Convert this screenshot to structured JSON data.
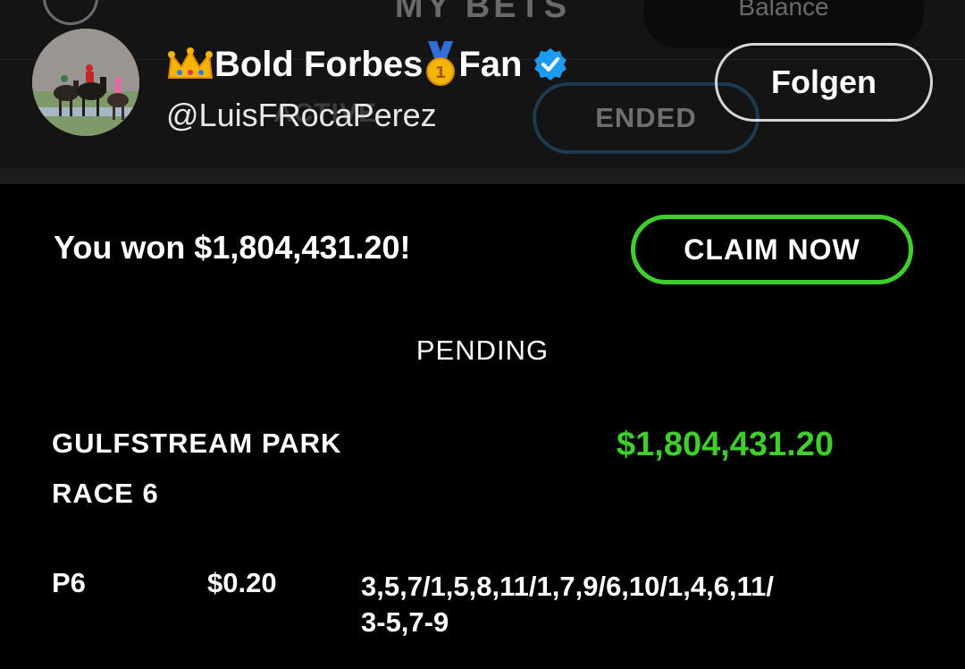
{
  "app_header": {
    "title": "MY BETS",
    "balance_label": "Balance",
    "tabs": [
      {
        "label": "ACTIVE",
        "selected": false
      },
      {
        "label": "ENDED",
        "selected": true
      }
    ]
  },
  "profile": {
    "display_name_prefix_emoji": "crown-emoji",
    "display_name_part1": "Bold Forbes",
    "display_name_middle_emoji": "medal-emoji",
    "display_name_part2": "Fan",
    "verified": true,
    "handle": "@LuisFRocaPerez",
    "follow_label": "Folgen"
  },
  "win_banner": {
    "message": "You won $1,804,431.20!",
    "claim_label": "CLAIM NOW"
  },
  "status": "PENDING",
  "bet": {
    "track": "GULFSTREAM PARK",
    "race": "RACE 6",
    "payout": "$1,804,431.20",
    "type": "P6",
    "amount": "$0.20",
    "selections_line1": "3,5,7/1,5,8,11/1,7,9/6,10/1,4,6,11/",
    "selections_line2": "3-5,7-9"
  },
  "colors": {
    "background": "#000000",
    "accent_green": "#3fce2b",
    "verified_blue": "#1d9bf0",
    "ended_tab_border": "#1d3a4e"
  }
}
